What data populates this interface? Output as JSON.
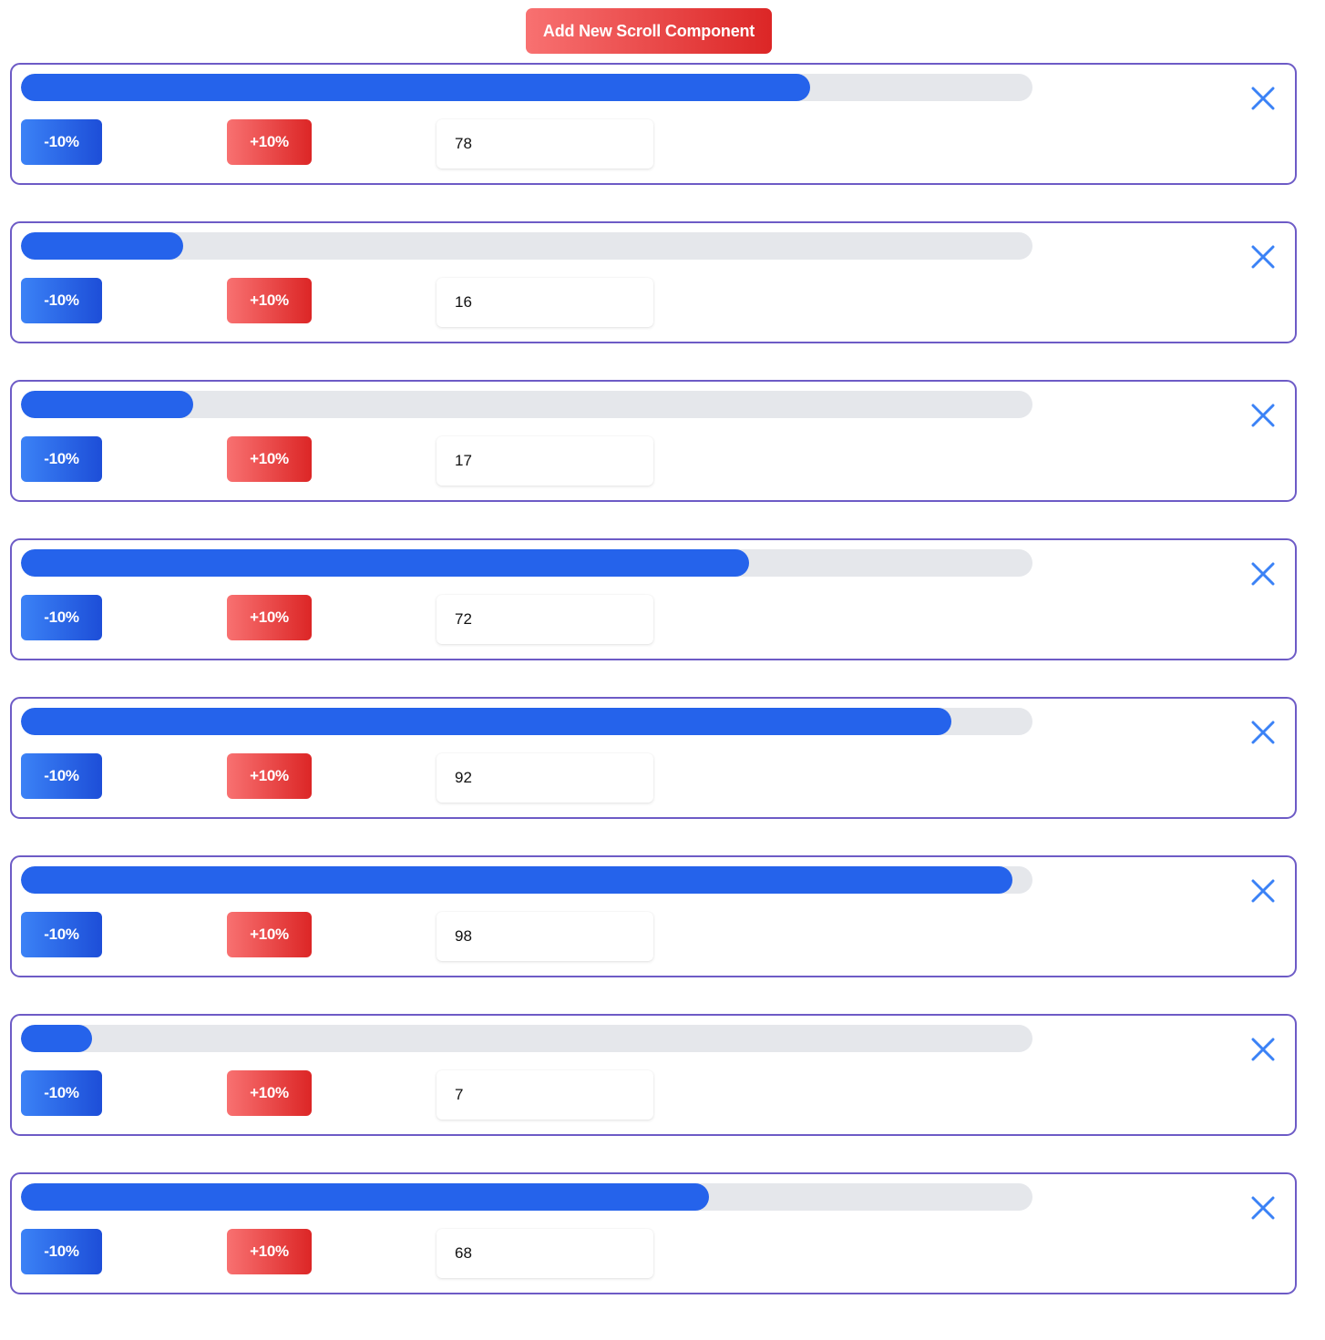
{
  "header": {
    "add_button_label": "Add New Scroll Component"
  },
  "components": [
    {
      "value": "78",
      "progress_percent": 78,
      "decrease_label": "-10%",
      "increase_label": "+10%"
    },
    {
      "value": "16",
      "progress_percent": 16,
      "decrease_label": "-10%",
      "increase_label": "+10%"
    },
    {
      "value": "17",
      "progress_percent": 17,
      "decrease_label": "-10%",
      "increase_label": "+10%"
    },
    {
      "value": "72",
      "progress_percent": 72,
      "decrease_label": "-10%",
      "increase_label": "+10%"
    },
    {
      "value": "92",
      "progress_percent": 92,
      "decrease_label": "-10%",
      "increase_label": "+10%"
    },
    {
      "value": "98",
      "progress_percent": 98,
      "decrease_label": "-10%",
      "increase_label": "+10%"
    },
    {
      "value": "7",
      "progress_percent": 7,
      "decrease_label": "-10%",
      "increase_label": "+10%"
    },
    {
      "value": "68",
      "progress_percent": 68,
      "decrease_label": "-10%",
      "increase_label": "+10%"
    }
  ],
  "icons": {
    "remove": "close-icon"
  },
  "colors": {
    "card_border": "#6d5bc6",
    "progress_fill": "#2563eb",
    "progress_track": "#e5e7eb",
    "decrease_button": "#2563eb",
    "increase_button": "#ef4444",
    "close_icon": "#3b82f6"
  }
}
